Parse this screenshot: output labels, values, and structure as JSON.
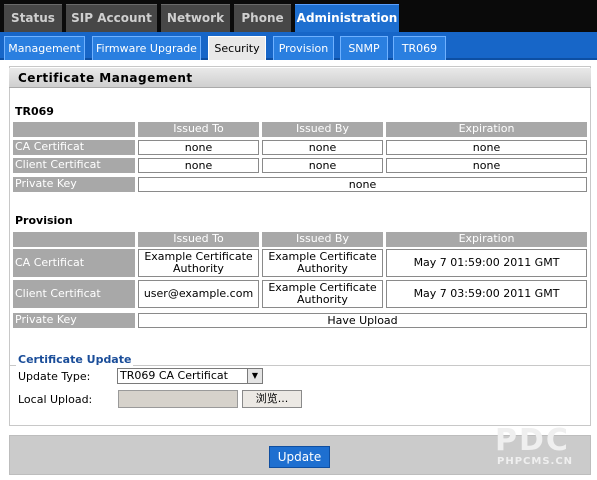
{
  "top_tabs": [
    "Status",
    "SIP Account",
    "Network",
    "Phone",
    "Administration"
  ],
  "sub_tabs": [
    "Management",
    "Firmware Upgrade",
    "Security",
    "Provision",
    "SNMP",
    "TR069"
  ],
  "panel_title": "Certificate Management",
  "columns": [
    "Issued To",
    "Issued By",
    "Expiration"
  ],
  "tr069": {
    "title": "TR069",
    "rows": [
      {
        "label": "CA Certificat",
        "issued_to": "none",
        "issued_by": "none",
        "expiration": "none"
      },
      {
        "label": "Client Certificat",
        "issued_to": "none",
        "issued_by": "none",
        "expiration": "none"
      }
    ],
    "private_key_label": "Private Key",
    "private_key_value": "none"
  },
  "provision": {
    "title": "Provision",
    "rows": [
      {
        "label": "CA Certificat",
        "issued_to": "Example Certificate Authority",
        "issued_by": "Example Certificate Authority",
        "expiration": "May 7 01:59:00 2011 GMT"
      },
      {
        "label": "Client Certificat",
        "issued_to": "user@example.com",
        "issued_by": "Example Certificate Authority",
        "expiration": "May 7 03:59:00 2011 GMT"
      }
    ],
    "private_key_label": "Private Key",
    "private_key_value": "Have Upload"
  },
  "update_section": {
    "legend": "Certificate Update",
    "update_type_label": "Update Type:",
    "update_type_value": "TR069 CA Certificat",
    "local_upload_label": "Local Upload:",
    "browse_label": "浏览..."
  },
  "update_button": "Update",
  "watermark": {
    "big": "PDC",
    "small": "PHPCMS.CN"
  },
  "colors": {
    "accent": "#1e6fd0",
    "header_gray": "#a8a8a8",
    "topbar": "#0a0a0a"
  }
}
